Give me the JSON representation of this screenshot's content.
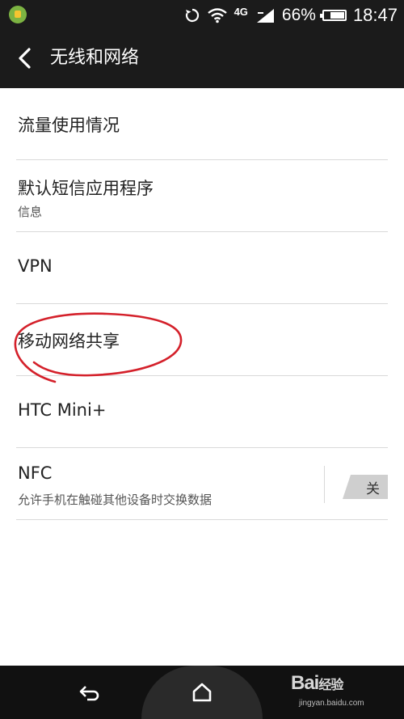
{
  "status_bar": {
    "battery": "66%",
    "time": "18:47",
    "network_label": "4G",
    "icons": [
      "app-notification-icon",
      "sync-icon",
      "wifi-icon",
      "network-4g-icon",
      "signal-icon",
      "battery-icon"
    ]
  },
  "header": {
    "title": "无线和网络",
    "back_icon": "back-arrow-icon"
  },
  "settings": [
    {
      "title": "流量使用情况"
    },
    {
      "title": "默认短信应用程序",
      "subtitle": "信息"
    },
    {
      "title": "VPN"
    },
    {
      "title": "移动网络共享"
    },
    {
      "title": "HTC Mini+"
    },
    {
      "title": "NFC",
      "subtitle": "允许手机在触碰其他设备时交换数据",
      "toggle": "关"
    }
  ],
  "annotation": {
    "color": "#d4202a",
    "highlighted_item": "移动网络共享"
  },
  "nav_bar": {
    "icons": [
      "back-icon",
      "home-icon"
    ],
    "watermark_text": "Bai",
    "watermark_suffix": "经验",
    "watermark_url": "jingyan.baidu.com"
  },
  "colors": {
    "bar": "#1b1b1b",
    "divider": "#d9d9d9",
    "text": "#222222"
  }
}
